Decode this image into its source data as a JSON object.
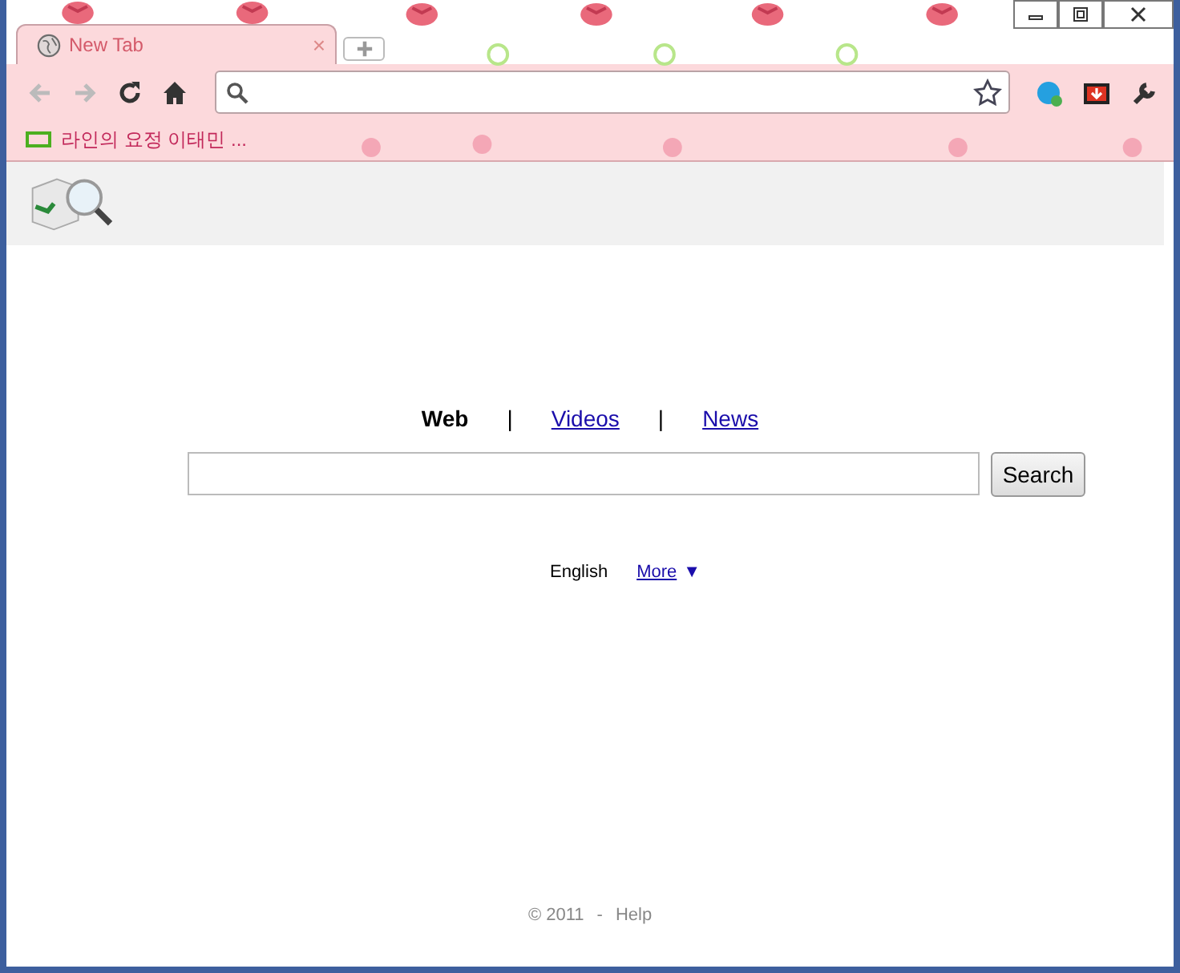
{
  "tab": {
    "title": "New Tab",
    "close": "×"
  },
  "bookmarks": [
    {
      "label": "라인의 요정 이태민 ..."
    }
  ],
  "search_tabs": [
    {
      "label": "Web",
      "selected": true
    },
    {
      "label": "Videos",
      "selected": false
    },
    {
      "label": "News",
      "selected": false
    }
  ],
  "separator": "|",
  "search": {
    "button": "Search"
  },
  "language": {
    "current": "English",
    "more": "More",
    "more_caret": "▼"
  },
  "footer": {
    "copyright": "© 2011",
    "dash": "-",
    "help": "Help"
  }
}
